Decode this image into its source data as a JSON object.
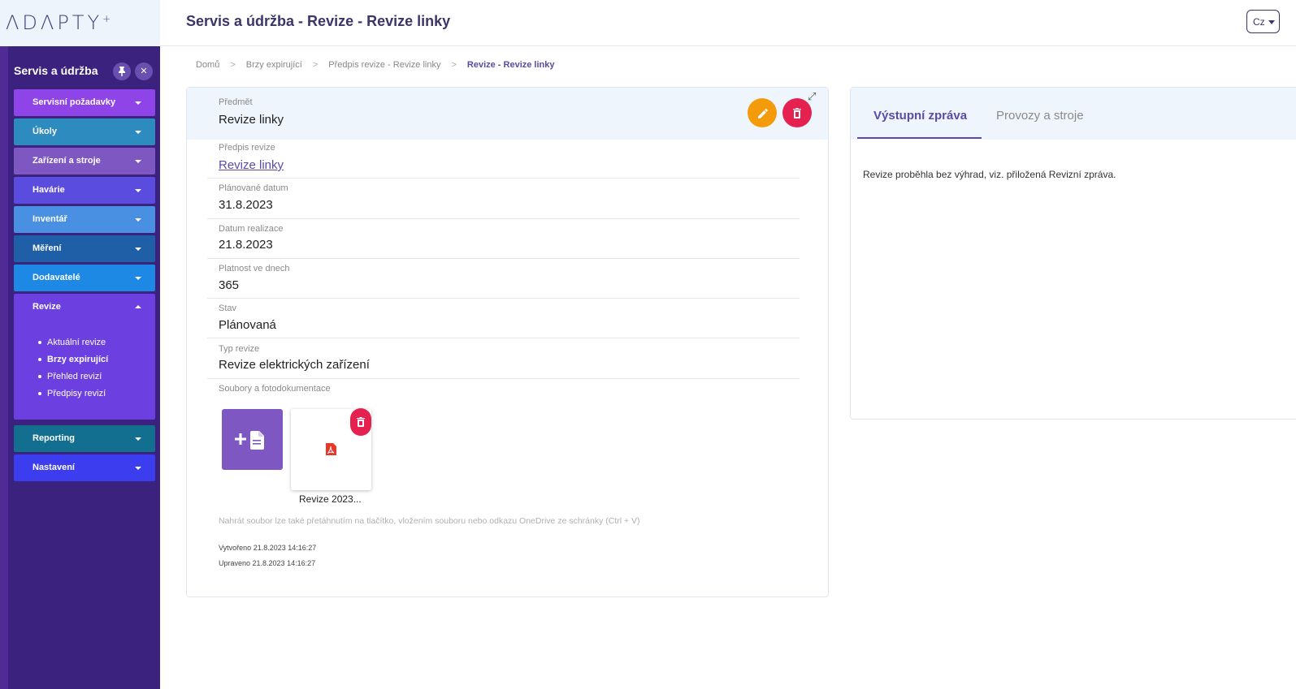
{
  "logo": {
    "text": "ADAPTY",
    "mark": "+"
  },
  "header": {
    "title": "Servis a údržba - Revize - Revize linky",
    "lang": "Cz"
  },
  "sidebar": {
    "heading": "Servis a údržba",
    "pin_icon": "pin-icon",
    "close_icon": "close-icon",
    "items": [
      {
        "label": "Servisní požadavky",
        "color": "#8e44e6"
      },
      {
        "label": "Úkoly",
        "color": "#2e8bc0"
      },
      {
        "label": "Zařízení a stroje",
        "color": "#7e57c2"
      },
      {
        "label": "Havárie",
        "color": "#5b4ce0"
      },
      {
        "label": "Inventář",
        "color": "#4a90e2"
      },
      {
        "label": "Měření",
        "color": "#1f5fa8"
      },
      {
        "label": "Dodavatelé",
        "color": "#1e88e5"
      },
      {
        "label": "Revize",
        "color": "#6c3fe0",
        "expanded": true
      },
      {
        "label": "Reporting",
        "color": "#136f8f"
      },
      {
        "label": "Nastavení",
        "color": "#3d3df0"
      }
    ],
    "revize_sub": [
      "Aktuální revize",
      "Brzy expirující",
      "Přehled revizí",
      "Předpisy revizí"
    ],
    "active_sub": "Brzy expirující"
  },
  "breadcrumb": [
    "Domů",
    "Brzy expirující",
    "Předpis revize - Revize linky",
    "Revize - Revize linky"
  ],
  "detail": {
    "subject_label": "Předmět",
    "subject_value": "Revize linky",
    "fields": [
      {
        "label": "Předpis revize",
        "value": "Revize linky",
        "link": true
      },
      {
        "label": "Plánované datum",
        "value": "31.8.2023"
      },
      {
        "label": "Datum realizace",
        "value": "21.8.2023"
      },
      {
        "label": "Platnost ve dnech",
        "value": "365"
      },
      {
        "label": "Stav",
        "value": "Plánovaná"
      },
      {
        "label": "Typ revize",
        "value": "Revize elektrických zařízení"
      }
    ],
    "files_label": "Soubory a fotodokumentace",
    "file_name": "Revize 2023...",
    "hint": "Nahrát soubor lze také přetáhnutím na tlačítko, vložením souboru nebo odkazu OneDrive ze schránky (Ctrl + V)",
    "created": "Vytvořeno 21.8.2023 14:16:27",
    "updated": "Upraveno 21.8.2023 14:16:27"
  },
  "panel": {
    "tabs": [
      "Výstupní zpráva",
      "Provozy a stroje"
    ],
    "text": "Revize proběhla bez výhrad, viz. přiložená Revizní zpráva."
  }
}
